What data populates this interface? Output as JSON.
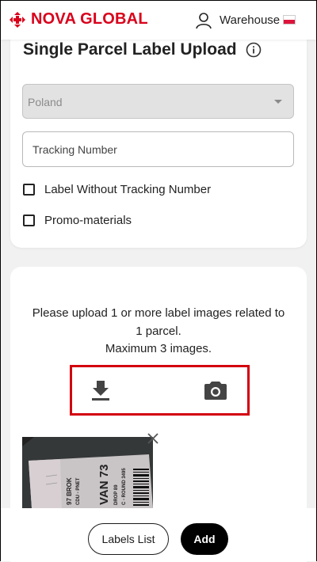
{
  "header": {
    "logo_text": "NOVA GLOBAL",
    "warehouse_label": "Warehouse",
    "brand_color": "#d9001b",
    "flag": "poland-flag"
  },
  "form": {
    "title": "Single Parcel Label Upload",
    "country_select": {
      "value": "Poland"
    },
    "tracking_input": {
      "placeholder": "Tracking Number"
    },
    "checkboxes": [
      {
        "label": "Label Without Tracking Number",
        "checked": false
      },
      {
        "label": "Promo-materials",
        "checked": false
      }
    ]
  },
  "upload": {
    "instruction_line1": "Please upload 1 or more label images related to",
    "instruction_line2": "1 parcel.",
    "instruction_line3": "Maximum 3 images.",
    "icons": [
      "download-icon",
      "camera-icon"
    ],
    "highlight_color": "#d3000f"
  },
  "thumbnail": {
    "label_lines": [
      "97 BROK",
      "CDU - PNET",
      "VAN 73",
      "DROP 89",
      "C - ROUND 3495"
    ]
  },
  "footer": {
    "labels_list_button": "Labels List",
    "add_button": "Add"
  }
}
